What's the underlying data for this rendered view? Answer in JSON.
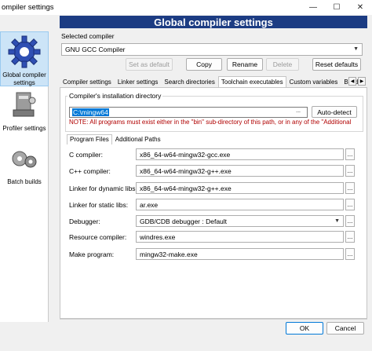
{
  "window": {
    "title": "ompiler settings",
    "controls": {
      "minimize": "—",
      "maximize": "☐",
      "close": "✕"
    }
  },
  "banner": {
    "title": "Global compiler settings"
  },
  "sidebar": {
    "items": [
      {
        "label": "Global compiler settings",
        "icon": "gear-icon",
        "selected": true
      },
      {
        "label": "Profiler settings",
        "icon": "profiler-icon",
        "selected": false
      },
      {
        "label": "Batch builds",
        "icon": "gears-icon",
        "selected": false
      }
    ]
  },
  "compiler": {
    "selected_label": "Selected compiler",
    "selected_value": "GNU GCC Compiler",
    "buttons": {
      "set_default": "Set as default",
      "copy": "Copy",
      "rename": "Rename",
      "delete": "Delete",
      "reset": "Reset defaults"
    }
  },
  "tabs": [
    {
      "label": "Compiler settings",
      "active": false
    },
    {
      "label": "Linker settings",
      "active": false
    },
    {
      "label": "Search directories",
      "active": false
    },
    {
      "label": "Toolchain executables",
      "active": true
    },
    {
      "label": "Custom variables",
      "active": false
    },
    {
      "label": "Build o",
      "active": false
    }
  ],
  "tab_scroll": {
    "left": "◀",
    "right": "▶"
  },
  "install_dir": {
    "group_title": "Compiler's installation directory",
    "value": "C:\\mingw64",
    "auto_detect": "Auto-detect",
    "note": "NOTE: All programs must exist either in the \"bin\" sub-directory of this path, or in any of the \"Additional"
  },
  "subtabs": [
    {
      "label": "Program Files",
      "active": true
    },
    {
      "label": "Additional Paths",
      "active": false
    }
  ],
  "programs": [
    {
      "label": "C compiler:",
      "value": "x86_64-w64-mingw32-gcc.exe",
      "type": "text"
    },
    {
      "label": "C++ compiler:",
      "value": "x86_64-w64-mingw32-g++.exe",
      "type": "text"
    },
    {
      "label": "Linker for dynamic libs:",
      "value": "x86_64-w64-mingw32-g++.exe",
      "type": "text"
    },
    {
      "label": "Linker for static libs:",
      "value": "ar.exe",
      "type": "text"
    },
    {
      "label": "Debugger:",
      "value": "GDB/CDB debugger : Default",
      "type": "dropdown"
    },
    {
      "label": "Resource compiler:",
      "value": "windres.exe",
      "type": "text"
    },
    {
      "label": "Make program:",
      "value": "mingw32-make.exe",
      "type": "text"
    }
  ],
  "browse_label": "...",
  "dialog": {
    "ok": "OK",
    "cancel": "Cancel"
  }
}
